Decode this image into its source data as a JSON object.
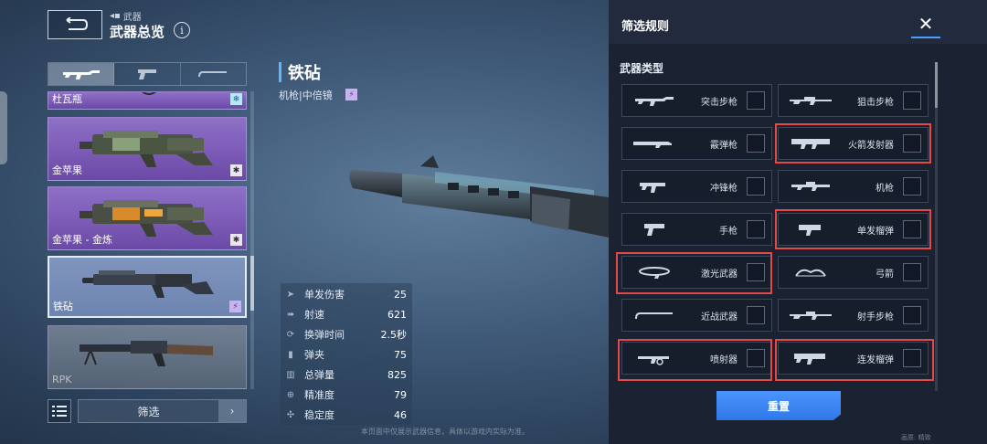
{
  "header": {
    "breadcrumb": "武器",
    "title": "武器总览",
    "info": "i"
  },
  "weapon_tabs": [
    "assault-rifle-tab",
    "pistol-tab",
    "melee-tab"
  ],
  "weapon_list": {
    "items": [
      {
        "name": "杜瓦瓶",
        "badge": "❄"
      },
      {
        "name": "金苹果",
        "badge": "✱"
      },
      {
        "name": "金苹果 - 金炼",
        "badge": "✱"
      },
      {
        "name": "铁砧",
        "badge": "⚡"
      },
      {
        "name": "RPK",
        "badge": ""
      }
    ],
    "filter_label": "筛选",
    "arrow": "›"
  },
  "detail": {
    "name": "铁砧",
    "subtitle": "机枪|中倍镜",
    "badge": "⚡",
    "stats": [
      {
        "label": "单发伤害",
        "value": "25"
      },
      {
        "label": "射速",
        "value": "621"
      },
      {
        "label": "换弹时间",
        "value": "2.5秒"
      },
      {
        "label": "弹夹",
        "value": "75"
      },
      {
        "label": "总弹量",
        "value": "825"
      },
      {
        "label": "精准度",
        "value": "79"
      },
      {
        "label": "稳定度",
        "value": "46"
      }
    ]
  },
  "footer_text": "本页面中仅展示武器信息，具体以游戏内实际为准。",
  "filter_panel": {
    "title": "筛选规则",
    "close": "✕",
    "section": "武器类型",
    "options": [
      {
        "label": "突击步枪",
        "highlighted": false
      },
      {
        "label": "狙击步枪",
        "highlighted": false
      },
      {
        "label": "霰弹枪",
        "highlighted": false
      },
      {
        "label": "火箭发射器",
        "highlighted": true
      },
      {
        "label": "冲锋枪",
        "highlighted": false
      },
      {
        "label": "机枪",
        "highlighted": false
      },
      {
        "label": "手枪",
        "highlighted": false
      },
      {
        "label": "单发榴弹",
        "highlighted": true
      },
      {
        "label": "激光武器",
        "highlighted": true
      },
      {
        "label": "弓箭",
        "highlighted": false
      },
      {
        "label": "近战武器",
        "highlighted": false
      },
      {
        "label": "射手步枪",
        "highlighted": false
      },
      {
        "label": "喷射器",
        "highlighted": true
      },
      {
        "label": "连发榴弹",
        "highlighted": true
      }
    ],
    "reset_label": "重置",
    "footer": "画质: 精致"
  },
  "colors": {
    "accent": "#4aa0ff",
    "highlight": "#e24a4a",
    "purple_card": "#7a59b5"
  }
}
